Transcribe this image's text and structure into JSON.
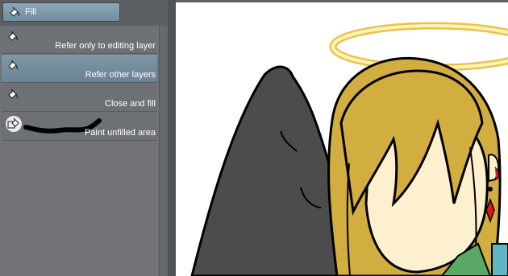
{
  "header": {
    "tab_label": "Fill",
    "tab_icon": "fill-bucket-icon"
  },
  "subtools": [
    {
      "label": "Refer only to editing layer",
      "icon": "fill-bucket-icon",
      "selected": false
    },
    {
      "label": "Refer other layers",
      "icon": "fill-bucket-icon",
      "selected": true
    },
    {
      "label": "Close and fill",
      "icon": "fill-bucket-icon",
      "selected": false
    },
    {
      "label": "Paint unfilled area",
      "icon": "fill-brush-icon",
      "selected": false
    }
  ],
  "colors": {
    "selected_item": "#7f97a7",
    "panel": "#707276",
    "hair": "#d4ad3e",
    "wing": "#4a4a4a",
    "halo": "#fdf3b8",
    "earring": "#e2141b"
  }
}
